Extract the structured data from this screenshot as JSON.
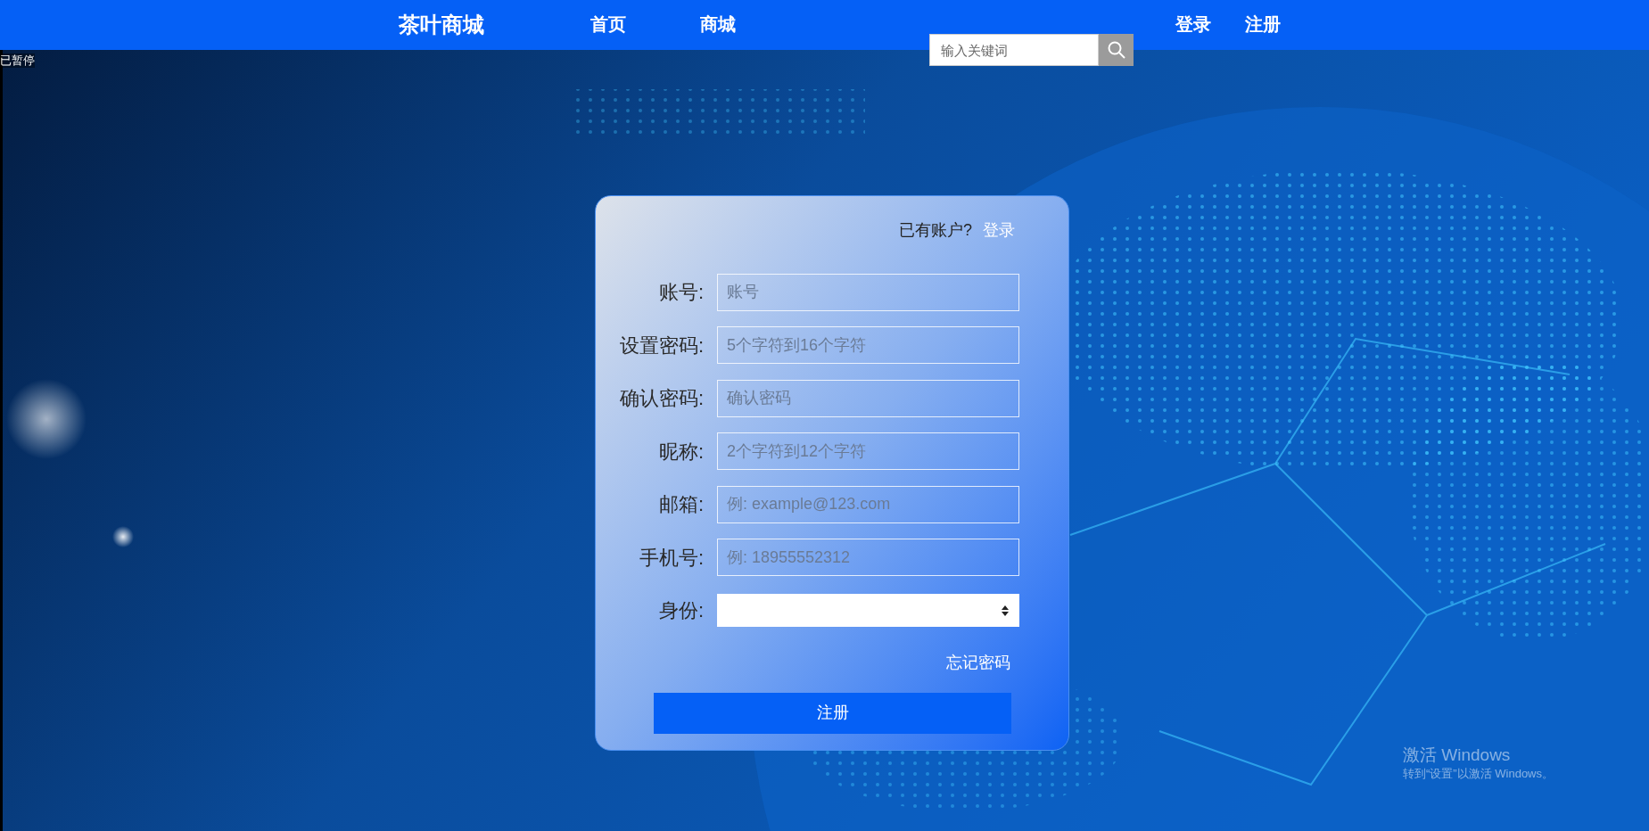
{
  "header": {
    "brand": "茶叶商城",
    "nav": [
      {
        "label": "首页"
      },
      {
        "label": "商城"
      }
    ],
    "search": {
      "placeholder": "输入关键词"
    },
    "auth_links": [
      {
        "label": "登录"
      },
      {
        "label": "注册"
      }
    ]
  },
  "video_status": "已暂停",
  "form": {
    "login_prompt": "已有账户?",
    "login_link": "登录",
    "fields": [
      {
        "kind": "text",
        "label": "账号:",
        "placeholder": "账号"
      },
      {
        "kind": "text",
        "label": "设置密码:",
        "placeholder": "5个字符到16个字符"
      },
      {
        "kind": "text",
        "label": "确认密码:",
        "placeholder": "确认密码"
      },
      {
        "kind": "text",
        "label": "昵称:",
        "placeholder": "2个字符到12个字符"
      },
      {
        "kind": "text",
        "label": "邮箱:",
        "placeholder": "例: example@123.com"
      },
      {
        "kind": "text",
        "label": "手机号:",
        "placeholder": "例: 18955552312"
      },
      {
        "kind": "select",
        "label": "身份:"
      }
    ],
    "forgot_link": "忘记密码",
    "submit": "注册"
  },
  "os_notice": {
    "title": "激活 Windows",
    "subtitle": "转到“设置”以激活 Windows。"
  }
}
